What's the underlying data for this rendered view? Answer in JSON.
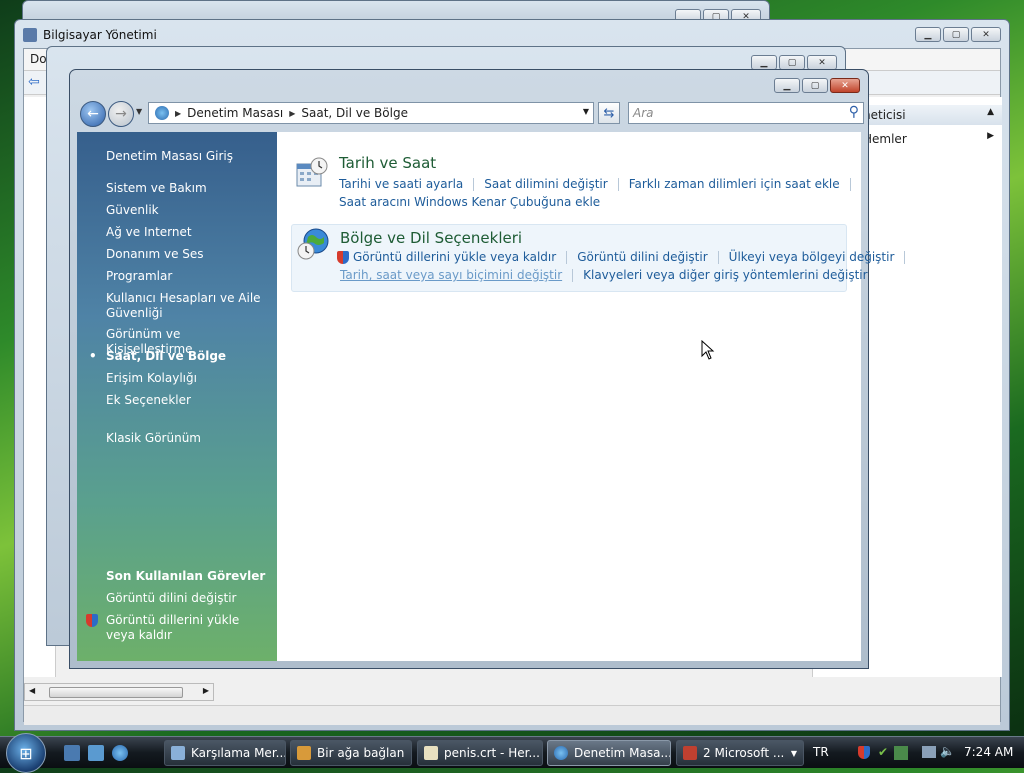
{
  "background_windows": {
    "computer_management": {
      "title": "Bilgisayar Yönetimi",
      "menu_first": "Do"
    },
    "right_panel": {
      "item1": "neticisi",
      "item2": "Hemler"
    }
  },
  "window": {
    "address": {
      "part1": "Denetim Masası",
      "part2": "Saat, Dil ve Bölge"
    },
    "search_placeholder": "Ara"
  },
  "sidebar": {
    "home": "Denetim Masası Giriş",
    "items": [
      "Sistem ve Bakım",
      "Güvenlik",
      "Ağ ve Internet",
      "Donanım ve Ses",
      "Programlar",
      "Kullanıcı Hesapları ve Aile Güvenliği",
      "Görünüm ve Kişiselleştirme",
      "Saat, Dil ve Bölge",
      "Erişim Kolaylığı",
      "Ek Seçenekler"
    ],
    "active_index": 7,
    "classic_view": "Klasik Görünüm",
    "recent_title": "Son Kullanılan Görevler",
    "recent_items": [
      "Görüntü dilini değiştir",
      "Görüntü dillerini yükle veya kaldır"
    ]
  },
  "categories": [
    {
      "title": "Tarih ve Saat",
      "icon": "calendar-clock-icon",
      "links_row1": [
        "Tarihi ve saati ayarla",
        "Saat dilimini değiştir",
        "Farklı zaman dilimleri için saat ekle"
      ],
      "links_row2": [
        "Saat aracını Windows Kenar Çubuğuna ekle"
      ]
    },
    {
      "title": "Bölge ve Dil Seçenekleri",
      "icon": "globe-clock-icon",
      "links_row1": [
        "Görüntü dillerini yükle veya kaldır",
        "Görüntü dilini değiştir",
        "Ülkeyi veya bölgeyi değiştir"
      ],
      "links_row2": [
        "Tarih, saat veya sayı biçimini değiştir",
        "Klavyeleri veya diğer giriş yöntemlerini değiştir"
      ]
    }
  ],
  "taskbar": {
    "items": [
      "Karşılama Mer...",
      "Bir ağa bağlan",
      "penis.crt - Her...",
      "Denetim Masa...",
      "2 Microsoft ..."
    ],
    "active_index": 3,
    "language": "TR",
    "clock": "7:24 AM"
  }
}
